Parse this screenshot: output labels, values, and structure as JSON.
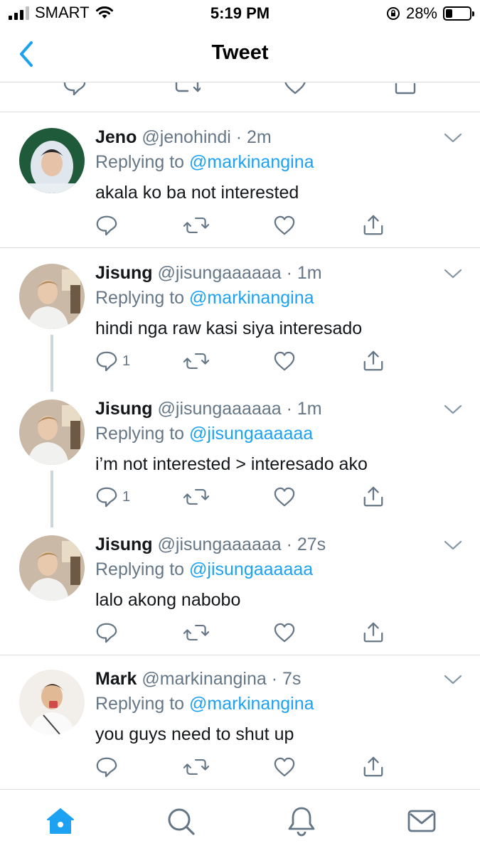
{
  "status_bar": {
    "carrier": "SMART",
    "time": "5:19 PM",
    "battery_percent": "28%",
    "battery_level": 0.28,
    "icons": [
      "signal-icon",
      "wifi-icon",
      "rotation-lock-icon",
      "battery-icon"
    ]
  },
  "nav": {
    "title": "Tweet",
    "back_icon": "chevron-left-icon"
  },
  "colors": {
    "accent": "#1da1f2",
    "text": "#14171a",
    "muted": "#657786",
    "divider": "#d8dde1"
  },
  "tweets": [
    {
      "name": "Jeno",
      "handle": "@jenohindi",
      "time": "2m",
      "replying_prefix": "Replying to",
      "replying_to": "@markinangina",
      "text": "akala ko ba not interested",
      "reply_count": ""
    },
    {
      "name": "Jisung",
      "handle": "@jisungaaaaaa",
      "time": "1m",
      "replying_prefix": "Replying to",
      "replying_to": "@markinangina",
      "text": "hindi nga raw kasi siya interesado",
      "reply_count": "1"
    },
    {
      "name": "Jisung",
      "handle": "@jisungaaaaaa",
      "time": "1m",
      "replying_prefix": "Replying to",
      "replying_to": "@jisungaaaaaa",
      "text": "i’m not interested > interesado ako",
      "reply_count": "1"
    },
    {
      "name": "Jisung",
      "handle": "@jisungaaaaaa",
      "time": "27s",
      "replying_prefix": "Replying to",
      "replying_to": "@jisungaaaaaa",
      "text": "lalo akong nabobo",
      "reply_count": ""
    },
    {
      "name": "Mark",
      "handle": "@markinangina",
      "time": "7s",
      "replying_prefix": "Replying to",
      "replying_to": "@markinangina",
      "text": "you guys need to shut up",
      "reply_count": ""
    }
  ],
  "tab_bar": {
    "tabs": [
      "home-icon",
      "search-icon",
      "notifications-icon",
      "messages-icon"
    ],
    "active": "home-icon"
  }
}
